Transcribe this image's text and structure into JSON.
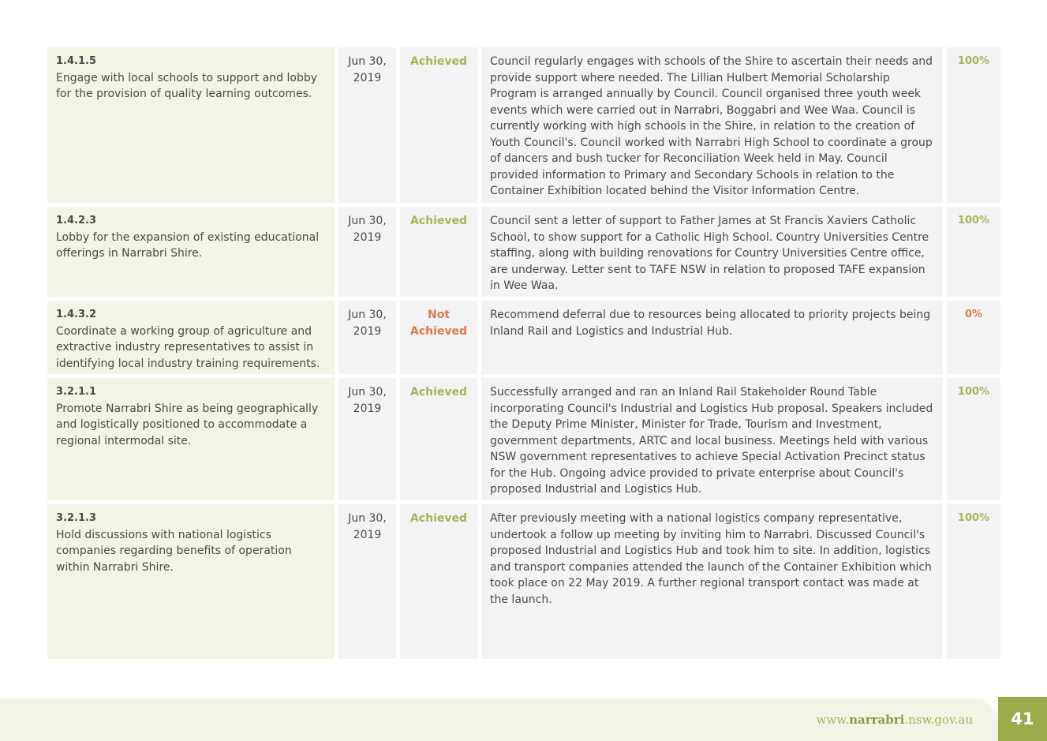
{
  "rows": [
    {
      "code": "1.4.1.5",
      "action": "Engage with local schools to support and lobby for the provision of quality learning outcomes.",
      "date": "Jun 30, 2019",
      "status": "Achieved",
      "comment": "Council regularly engages with schools of the Shire to ascertain their needs and provide support where needed. The Lillian Hulbert Memorial Scholarship Program is arranged annually by Council. Council organised three youth week events which were carried out in Narrabri, Boggabri and Wee Waa. Council is currently working with high schools in the Shire, in relation to the creation of Youth Council's. Council worked with Narrabri High School to coordinate a group of dancers and bush tucker for Reconciliation Week held in May. Council provided information to Primary and Secondary Schools in relation to the Container Exhibition located behind the Visitor Information Centre.",
      "percent": "100%"
    },
    {
      "code": "1.4.2.3",
      "action": "Lobby for the expansion of existing educational offerings in Narrabri Shire.",
      "date": "Jun 30, 2019",
      "status": "Achieved",
      "comment": "Council sent a letter of support to Father James at St Francis Xaviers Catholic School, to show support for a Catholic High School. Country Universities Centre staffing, along with building renovations for Country Universities Centre office, are underway. Letter sent to TAFE NSW in relation to proposed TAFE expansion in Wee Waa.",
      "percent": "100%"
    },
    {
      "code": "1.4.3.2",
      "action": "Coordinate a working group of agriculture and extractive industry representatives to assist in identifying local industry training requirements.",
      "date": "Jun 30, 2019",
      "status": "Not Achieved",
      "comment": "Recommend deferral due to resources being allocated to priority projects being Inland Rail and Logistics and Industrial Hub.",
      "percent": "0%"
    },
    {
      "code": "3.2.1.1",
      "action": "Promote Narrabri Shire as being geographically and logistically positioned to accommodate a regional intermodal site.",
      "date": "Jun 30, 2019",
      "status": "Achieved",
      "comment": "Successfully arranged and ran an Inland Rail Stakeholder Round Table incorporating Council's Industrial and Logistics Hub proposal. Speakers included the Deputy Prime Minister, Minister for Trade, Tourism and Investment, government departments, ARTC and local business. Meetings held with various NSW government representatives to achieve Special Activation Precinct status for the Hub. Ongoing advice provided to private enterprise about Council's proposed Industrial and Logistics Hub.",
      "percent": "100%"
    },
    {
      "code": "3.2.1.3",
      "action": "Hold discussions with national logistics companies regarding benefits of operation within Narrabri Shire.",
      "date": "Jun 30, 2019",
      "status": "Achieved",
      "comment": "After previously meeting with a national logistics company representative, undertook a follow up meeting by inviting him to Narrabri. Discussed Council's proposed Industrial and Logistics Hub and took him to site. In addition, logistics and transport companies attended the launch of the Container Exhibition which took place on 22 May 2019. A further regional transport contact was made at the launch.",
      "percent": "100%"
    }
  ],
  "footer": {
    "url_prefix": "www.",
    "url_brand": "narrabri",
    "url_suffix": ".nsw.gov.au",
    "page_number": "41"
  },
  "colors": {
    "achieved": "#a6b55c",
    "not_achieved": "#e0784f",
    "action_bg": "#f2f4e5",
    "cell_bg": "#f2f3f2",
    "page_badge": "#9aab4a"
  }
}
